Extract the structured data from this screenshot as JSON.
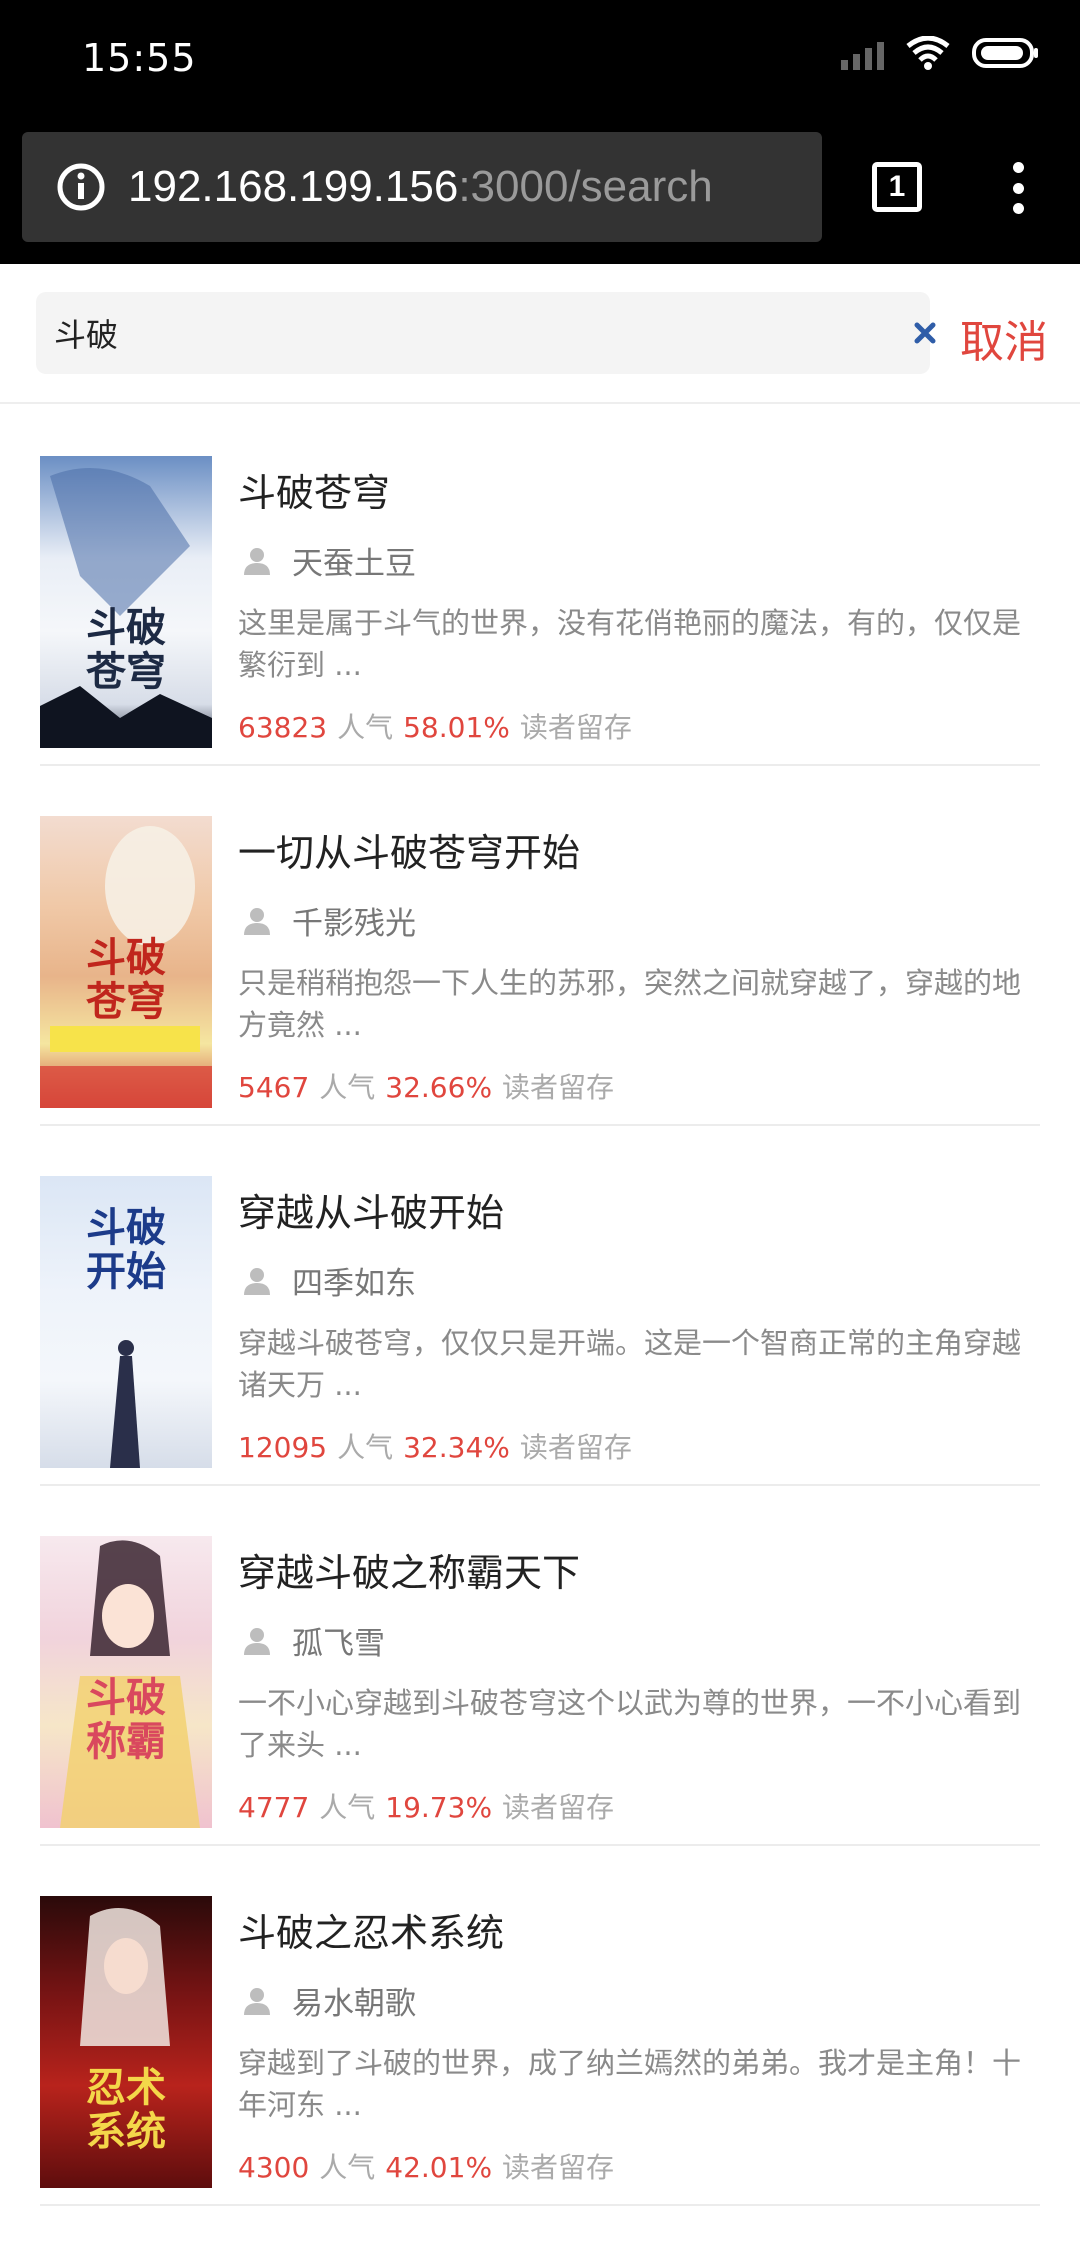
{
  "status_bar": {
    "time": "15:55",
    "icons": [
      "signal-icon",
      "wifi-icon",
      "battery-icon"
    ]
  },
  "browser": {
    "url_host": "192.168.199.156",
    "url_path": ":3000/search",
    "tab_count": "1"
  },
  "search": {
    "query": "斗破",
    "cancel_label": "取消"
  },
  "colors": {
    "accent": "#e0463e",
    "muted_text": "#8a8a8a"
  },
  "results": [
    {
      "title": "斗破苍穹",
      "author": "天蚕土豆",
      "description": "这里是属于斗气的世界，没有花俏艳丽的魔法，有的，仅仅是繁衍到 ...",
      "popularity": "63823",
      "popularity_label": "人气",
      "retention": "58.01%",
      "retention_label": "读者留存"
    },
    {
      "title": "一切从斗破苍穹开始",
      "author": "千影残光",
      "description": "只是稍稍抱怨一下人生的苏邪，突然之间就穿越了，穿越的地方竟然 ...",
      "popularity": "5467",
      "popularity_label": "人气",
      "retention": "32.66%",
      "retention_label": "读者留存"
    },
    {
      "title": "穿越从斗破开始",
      "author": "四季如东",
      "description": "穿越斗破苍穹，仅仅只是开端。这是一个智商正常的主角穿越诸天万 ...",
      "popularity": "12095",
      "popularity_label": "人气",
      "retention": "32.34%",
      "retention_label": "读者留存"
    },
    {
      "title": "穿越斗破之称霸天下",
      "author": "孤飞雪",
      "description": "一不小心穿越到斗破苍穹这个以武为尊的世界，一不小心看到了来头 ...",
      "popularity": "4777",
      "popularity_label": "人气",
      "retention": "19.73%",
      "retention_label": "读者留存"
    },
    {
      "title": "斗破之忍术系统",
      "author": "易水朝歌",
      "description": "穿越到了斗破的世界，成了纳兰嫣然的弟弟。我才是主角！十年河东 ...",
      "popularity": "4300",
      "popularity_label": "人气",
      "retention": "42.01%",
      "retention_label": "读者留存"
    }
  ]
}
